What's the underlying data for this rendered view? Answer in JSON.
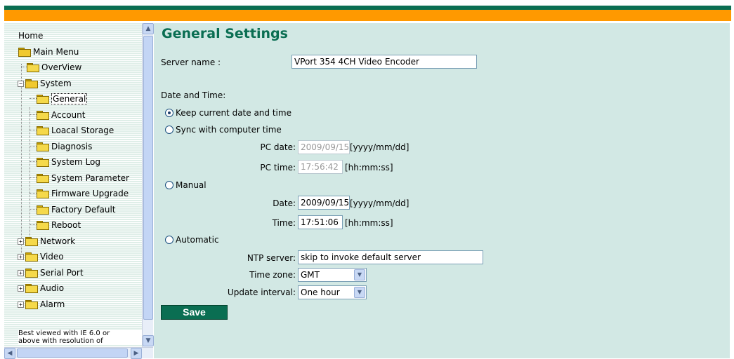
{
  "colors": {
    "brand_green": "#0a6e52",
    "brand_orange": "#ff9900",
    "panel_bg": "#d2e8e4"
  },
  "sidebar": {
    "home": "Home",
    "main_menu": "Main Menu",
    "overview": "OverView",
    "system": "System",
    "system_items": [
      "General",
      "Account",
      "Loacal Storage",
      "Diagnosis",
      "System Log",
      "System Parameter",
      "Firmware Upgrade",
      "Factory Default",
      "Reboot"
    ],
    "groups": [
      "Network",
      "Video",
      "Serial Port",
      "Audio",
      "Alarm"
    ],
    "selected": "General",
    "best_viewed_line1": "Best viewed with IE 6.0 or",
    "best_viewed_line2": "above with resolution of"
  },
  "page": {
    "title": "General Settings",
    "server_name_label": "Server name :",
    "server_name_value": "VPort 354 4CH Video Encoder",
    "date_time_label": "Date and Time:",
    "options": {
      "keep": "Keep current date and time",
      "sync": "Sync with computer time",
      "manual": "Manual",
      "automatic": "Automatic"
    },
    "selected_option": "keep",
    "pc_date_label": "PC date:",
    "pc_date_value": "2009/09/15",
    "pc_date_hint": "[yyyy/mm/dd]",
    "pc_time_label": "PC time:",
    "pc_time_value": "17:56:42",
    "pc_time_hint": "[hh:mm:ss]",
    "date_label": "Date:",
    "date_value": "2009/09/15",
    "date_hint": "[yyyy/mm/dd]",
    "time_label": "Time:",
    "time_value": "17:51:06",
    "time_hint": "[hh:mm:ss]",
    "ntp_label": "NTP server:",
    "ntp_value": "skip to invoke default server",
    "tz_label": "Time zone:",
    "tz_value": "GMT",
    "interval_label": "Update interval:",
    "interval_value": "One hour",
    "save_label": "Save"
  }
}
